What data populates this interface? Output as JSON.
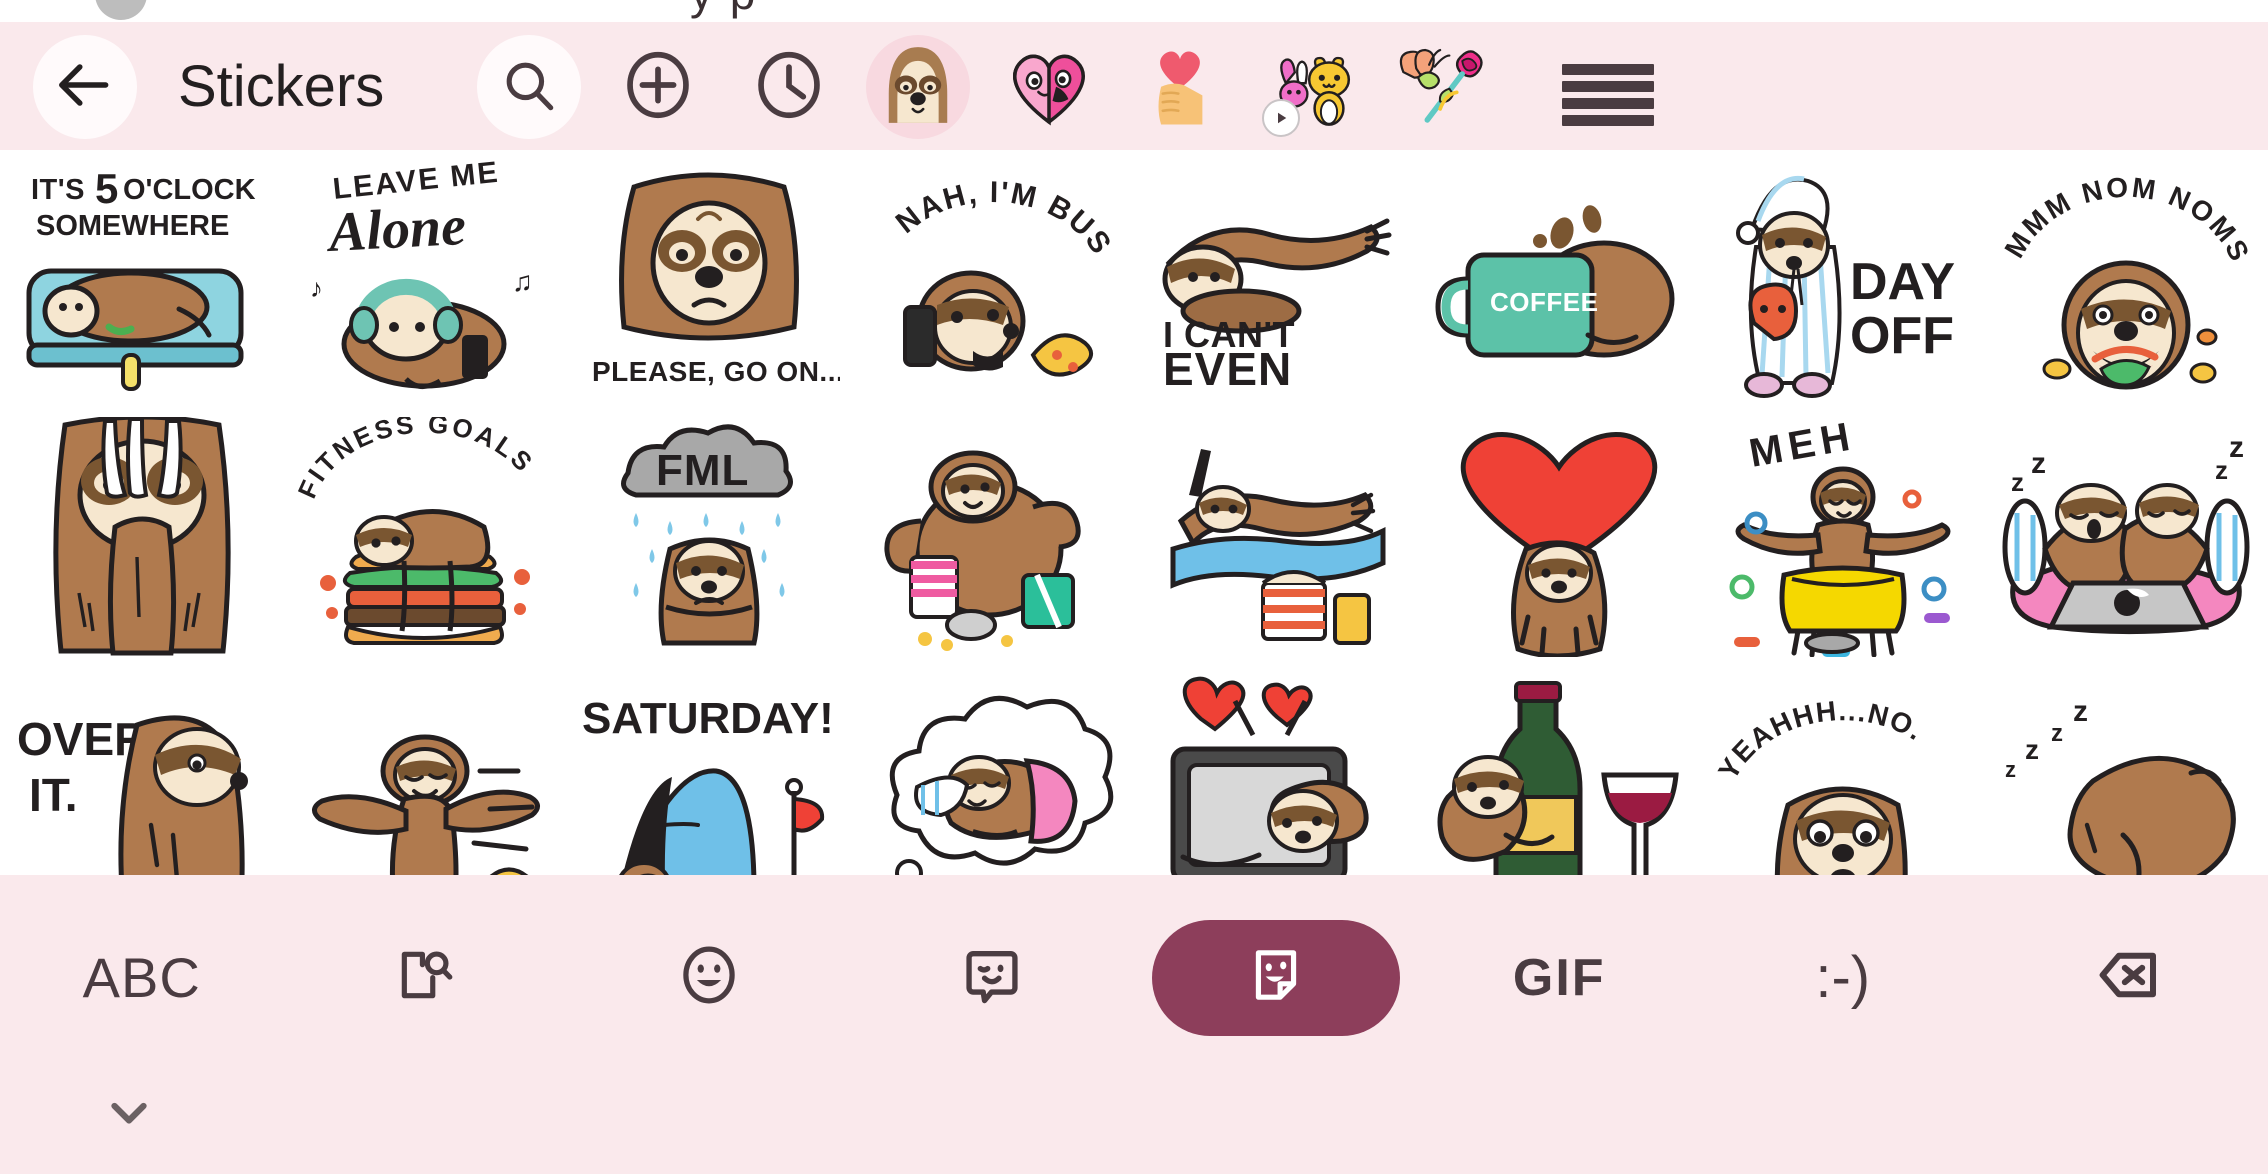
{
  "remnant": {
    "partial_text": "y p"
  },
  "header": {
    "title": "Stickers",
    "back_icon": "arrow-left-icon",
    "search_icon": "search-icon",
    "add_icon": "plus-circle-icon",
    "recent_icon": "clock-icon",
    "menu_icon": "hamburger-menu-icon",
    "packs": [
      {
        "name": "sloth-pack",
        "label": "Sloth Life",
        "selected": true,
        "animated": false
      },
      {
        "name": "love-heart-pack",
        "label": "Love Couple",
        "selected": false,
        "animated": false
      },
      {
        "name": "hand-heart-pack",
        "label": "Hand Heart",
        "selected": false,
        "animated": false
      },
      {
        "name": "yellow-cat-pack",
        "label": "Cat & Bunny",
        "selected": false,
        "animated": true
      },
      {
        "name": "butterfly-rose-pack",
        "label": "Butterfly Rose",
        "selected": false,
        "animated": false
      }
    ]
  },
  "stickers": {
    "rows": 3,
    "columns": 8,
    "items": [
      {
        "id": "five-oclock-somewhere",
        "caption": "IT'S 5 O'CLOCK SOMEWHERE",
        "caption2": "",
        "accent": "#8ed4e0"
      },
      {
        "id": "leave-me-alone",
        "caption": "LEAVE ME",
        "caption2": "Alone",
        "accent": "#6ec4b3"
      },
      {
        "id": "please-go-on",
        "caption": "PLEASE, GO ON...",
        "caption2": "",
        "accent": "#b07a4e"
      },
      {
        "id": "nah-im-busy",
        "caption": "NAH, I'M BUSY",
        "caption2": "",
        "accent": "#f5c542"
      },
      {
        "id": "i-cant-even",
        "caption": "I CAN'T",
        "caption2": "EVEN",
        "accent": "#231f20"
      },
      {
        "id": "coffee-mug",
        "caption": "COFFEE",
        "caption2": "",
        "accent": "#5cc2a8"
      },
      {
        "id": "day-off",
        "caption": "DAY",
        "caption2": "OFF",
        "accent": "#a8d8ef"
      },
      {
        "id": "mmm-nom-noms",
        "caption": "MMM NOM NOMS",
        "caption2": "",
        "accent": "#e8603c"
      },
      {
        "id": "claws-face",
        "caption": "",
        "caption2": "",
        "accent": "#b07a4e"
      },
      {
        "id": "fitness-goals",
        "caption": "FITNESS GOALS",
        "caption2": "",
        "accent": "#f0ab4e"
      },
      {
        "id": "fml-rain-cloud",
        "caption": "FML",
        "caption2": "",
        "accent": "#a8a8a8"
      },
      {
        "id": "flexing-snacks",
        "caption": "",
        "caption2": "",
        "accent": "#ef5ba1"
      },
      {
        "id": "movie-recliner",
        "caption": "",
        "caption2": "",
        "accent": "#6fc0e8"
      },
      {
        "id": "heart-hug",
        "caption": "",
        "caption2": "",
        "accent": "#ef4136"
      },
      {
        "id": "meh-laundry",
        "caption": "MEH",
        "caption2": "",
        "accent": "#f5d800"
      },
      {
        "id": "laptop-bed-zzz",
        "caption": "",
        "caption2": "",
        "accent": "#f487bf"
      },
      {
        "id": "over-it",
        "caption": "OVER",
        "caption2": "IT.",
        "accent": "#231f20"
      },
      {
        "id": "snow-angel",
        "caption": "",
        "caption2": "",
        "accent": "#f5c542"
      },
      {
        "id": "saturday-tent",
        "caption": "SATURDAY!",
        "caption2": "",
        "accent": "#6fc0e8"
      },
      {
        "id": "dreaming-of-bed",
        "caption": "",
        "caption2": "",
        "accent": "#f487bf"
      },
      {
        "id": "tv-hug-hearts",
        "caption": "",
        "caption2": "",
        "accent": "#ef4136"
      },
      {
        "id": "wine-hug",
        "caption": "",
        "caption2": "",
        "accent": "#9b1b42"
      },
      {
        "id": "yeahhh-no",
        "caption": "YEAHHH...NO.",
        "caption2": "",
        "accent": "#231f20"
      },
      {
        "id": "sleeping-zzz",
        "caption": "z z z z",
        "caption2": "",
        "accent": "#b07a4e"
      }
    ]
  },
  "keyboard": {
    "keys": [
      {
        "name": "abc-key",
        "label": "ABC",
        "icon": "",
        "selected": false
      },
      {
        "name": "clipboard-search-key",
        "label": "",
        "icon": "document-search-icon",
        "selected": false
      },
      {
        "name": "emoji-key",
        "label": "",
        "icon": "emoji-smiley-icon",
        "selected": false
      },
      {
        "name": "avatar-key",
        "label": "",
        "icon": "avatar-bubble-icon",
        "selected": false
      },
      {
        "name": "sticker-key",
        "label": "",
        "icon": "sticker-icon",
        "selected": true
      },
      {
        "name": "gif-key",
        "label": "GIF",
        "icon": "",
        "selected": false
      },
      {
        "name": "emoticon-key",
        "label": ":-)",
        "icon": "",
        "selected": false
      },
      {
        "name": "backspace-key",
        "label": "",
        "icon": "backspace-icon",
        "selected": false
      }
    ],
    "collapse_icon": "chevron-down-icon"
  },
  "colors": {
    "header_bg": "#fae9ec",
    "keyboard_bg": "#fae9ec",
    "accent_selected": "#8d3e5b",
    "pack_selected_bg": "#f8d9e0",
    "icon": "#4a3c41",
    "text": "#231f20",
    "sloth_body": "#b07a4e",
    "sloth_face": "#f6e7cf"
  }
}
